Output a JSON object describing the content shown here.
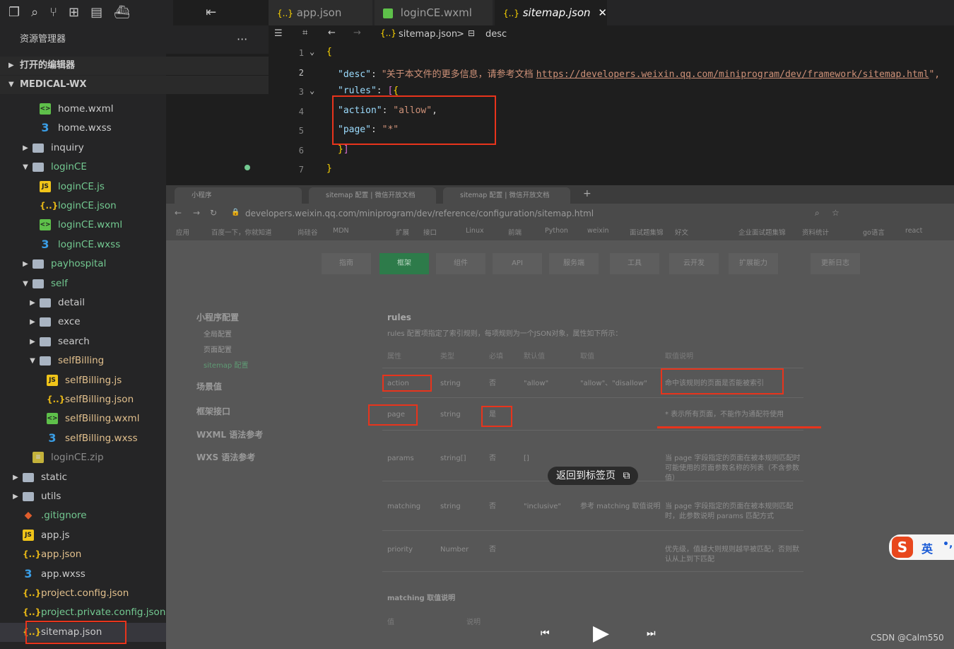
{
  "sidebar": {
    "title": "资源管理器",
    "more": "···",
    "open_editors": "打开的编辑器",
    "project": "MEDICAL-WX",
    "items": [
      {
        "label": "home.wxml",
        "type": "wxml",
        "depth": 2
      },
      {
        "label": "home.wxss",
        "type": "wxss",
        "depth": 2
      },
      {
        "label": "inquiry",
        "type": "folder",
        "depth": 1,
        "open": false
      },
      {
        "label": "loginCE",
        "type": "folder",
        "depth": 1,
        "open": true
      },
      {
        "label": "loginCE.js",
        "type": "js",
        "depth": 2
      },
      {
        "label": "loginCE.json",
        "type": "json",
        "depth": 2
      },
      {
        "label": "loginCE.wxml",
        "type": "wxml",
        "depth": 2
      },
      {
        "label": "loginCE.wxss",
        "type": "wxss",
        "depth": 2
      },
      {
        "label": "payhospital",
        "type": "folder",
        "depth": 1,
        "open": false
      },
      {
        "label": "self",
        "type": "folder",
        "depth": 1,
        "open": true
      },
      {
        "label": "detail",
        "type": "folder",
        "depth": 2,
        "open": false
      },
      {
        "label": "exce",
        "type": "folder",
        "depth": 2,
        "open": false
      },
      {
        "label": "search",
        "type": "folder",
        "depth": 2,
        "open": false
      },
      {
        "label": "selfBilling",
        "type": "folder",
        "depth": 2,
        "open": true
      },
      {
        "label": "selfBilling.js",
        "type": "js",
        "depth": 3
      },
      {
        "label": "selfBilling.json",
        "type": "json",
        "depth": 3
      },
      {
        "label": "selfBilling.wxml",
        "type": "wxml",
        "depth": 3
      },
      {
        "label": "selfBilling.wxss",
        "type": "wxss",
        "depth": 3
      },
      {
        "label": "loginCE.zip",
        "type": "zip",
        "depth": 1
      },
      {
        "label": "static",
        "type": "folder",
        "depth": 0,
        "open": false
      },
      {
        "label": "utils",
        "type": "folder",
        "depth": 0,
        "open": false
      },
      {
        "label": ".gitignore",
        "type": "git",
        "depth": 0
      },
      {
        "label": "app.js",
        "type": "js",
        "depth": 0
      },
      {
        "label": "app.json",
        "type": "json",
        "depth": 0
      },
      {
        "label": "app.wxss",
        "type": "wxss",
        "depth": 0
      },
      {
        "label": "project.config.json",
        "type": "json",
        "depth": 0
      },
      {
        "label": "project.private.config.json",
        "type": "json",
        "depth": 0
      },
      {
        "label": "sitemap.json",
        "type": "json",
        "depth": 0
      }
    ]
  },
  "tabs": [
    {
      "label": "app.json"
    },
    {
      "label": "loginCE.wxml"
    },
    {
      "label": "sitemap.json",
      "active": true
    }
  ],
  "breadcrumb": {
    "file": "sitemap.json",
    "sep": ">",
    "node": "desc"
  },
  "editor": {
    "lines": [
      "1",
      "2",
      "3",
      "4",
      "5",
      "6",
      "7"
    ],
    "desc_key": "\"desc\"",
    "desc_value": "\"关于本文件的更多信息，请参考文档 ",
    "desc_url": "https://developers.weixin.qq.com/miniprogram/dev/framework/sitemap.html",
    "desc_end": "\",",
    "rules_key": "\"rules\"",
    "action_key": "\"action\"",
    "action_value": "\"allow\"",
    "page_key": "\"page\"",
    "page_value": "\"*\""
  },
  "browser": {
    "tabs": [
      "小程序",
      "sitemap 配置 | 微信开放文档",
      "sitemap 配置 | 微信开放文档"
    ],
    "url": "developers.weixin.qq.com/miniprogram/dev/reference/configuration/sitemap.html",
    "bookmarks": [
      "应用",
      "百度一下，你就知道",
      "尚硅谷",
      "MDN",
      "扩展",
      "接口",
      "Linux",
      "前端",
      "Python",
      "weixin",
      "面试题集锦",
      "好文",
      "企业面试题集锦",
      "资料统计",
      "go语言",
      "react"
    ],
    "nav": [
      "指南",
      "框架",
      "组件",
      "API",
      "服务端",
      "工具",
      "云开发",
      "扩展能力",
      "更新日志"
    ],
    "side_menu": [
      "小程序配置",
      "全局配置",
      "页面配置",
      "sitemap 配置",
      "场景值",
      "框架接口",
      "WXML 语法参考",
      "WXS 语法参考"
    ],
    "section_title": "rules",
    "section_desc": "rules 配置项指定了索引规则，每项规则为一个JSON对象，属性如下所示：",
    "table_headers": [
      "属性",
      "类型",
      "必填",
      "默认值",
      "取值",
      "取值说明"
    ],
    "rows": [
      [
        "action",
        "string",
        "否",
        "\"allow\"",
        "\"allow\"、\"disallow\"",
        "命中该规则的页面是否能被索引"
      ],
      [
        "page",
        "string",
        "是",
        "",
        "",
        "* 表示所有页面，不能作为通配符使用"
      ],
      [
        "params",
        "string[]",
        "否",
        "[]",
        "",
        "当 page 字段指定的页面在被本规则匹配时可能使用的页面参数名称的列表（不含参数值）"
      ],
      [
        "matching",
        "string",
        "否",
        "\"inclusive\"",
        "参考 matching 取值说明",
        "当 page 字段指定的页面在被本规则匹配时，此参数说明 params 匹配方式"
      ],
      [
        "priority",
        "Number",
        "否",
        "",
        "",
        "优先级，值越大则规则越早被匹配，否则默认从上到下匹配"
      ]
    ],
    "matching_title": "matching 取值说明",
    "matching_headers": [
      "值",
      "说明"
    ],
    "return_tip": "返回到标签页"
  },
  "ime": {
    "label": "英"
  },
  "watermark": "CSDN @Calm550"
}
